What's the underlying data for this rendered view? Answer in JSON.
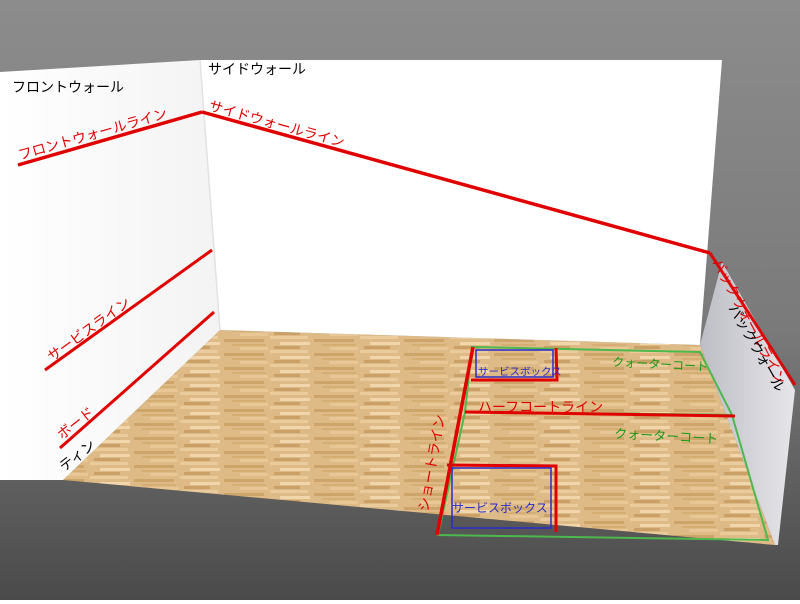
{
  "labels": {
    "front_wall": "フロントウォール",
    "side_wall": "サイドウォール",
    "back_wall": "バックウォール",
    "front_wall_line": "フロントウォールライン",
    "side_wall_line": "サイドウォールライン",
    "back_wall_line": "バックウォールライン",
    "service_line": "サービスライン",
    "board": "ボード",
    "tin": "ティン",
    "short_line": "ショートライン",
    "half_court_line": "ハーフコートライン",
    "quarter_court_upper": "クォーターコート",
    "quarter_court_lower": "クォーターコート",
    "service_box_upper": "サービスボックス",
    "service_box_lower": "サービスボックス"
  },
  "colors": {
    "court_line": "#e00000",
    "quarter_text": "#1a9a1a",
    "quarter_line": "#4db84d",
    "service_box": "#2a2ac8",
    "label_black": "#000000",
    "background_top": "#8a8a8a",
    "background_bottom": "#505050",
    "floor_base": "#d9b47a"
  }
}
